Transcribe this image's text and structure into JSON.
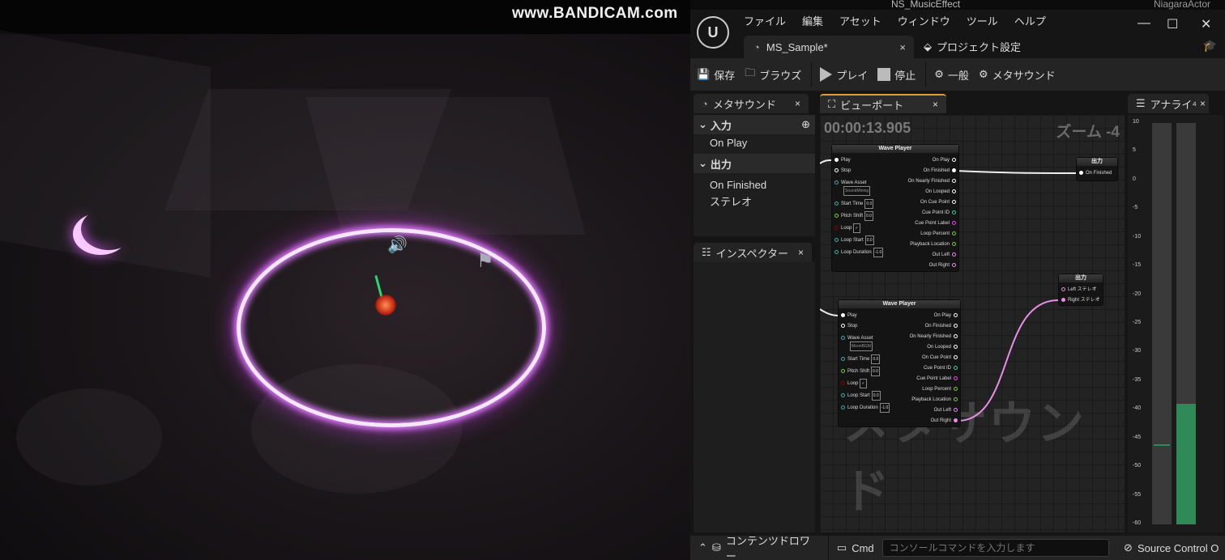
{
  "scene": {
    "watermark": "www.BANDICAM.com",
    "top_label_left": "NS_MusicEffect",
    "top_label_right": "NiagaraActor"
  },
  "window": {
    "logo": "U",
    "menu": [
      "ファイル",
      "編集",
      "アセット",
      "ウィンドウ",
      "ツール",
      "ヘルプ"
    ],
    "controls": {
      "minimize": "—",
      "maximize": "☐",
      "close": "✕"
    },
    "doc_tab": "MS_Sample*",
    "doc_tab_close": "×",
    "project_settings": "プロジェクト設定"
  },
  "toolbar": {
    "save": "保存",
    "browse": "ブラウズ",
    "play": "プレイ",
    "stop": "停止",
    "general": "一般",
    "metasound": "メタサウンド"
  },
  "panels": {
    "metasound_tab": "メタサウンド",
    "viewport_tab": "ビューポート",
    "analyzer_tab": "アナライ⁴",
    "inspector_tab": "インスペクター",
    "close": "×"
  },
  "members": {
    "inputs_header": "入力",
    "inputs": [
      "On Play"
    ],
    "outputs_header": "出力",
    "outputs": [
      "On Finished",
      "ステレオ"
    ]
  },
  "graph": {
    "timecode": "00:00:13.905",
    "zoom": "ズーム -4",
    "watermark": "メタサウンド",
    "nodes": [
      {
        "title": "Wave Player",
        "inputs": [
          "Play",
          "Stop",
          "Wave Asset",
          "Start Time",
          "Pitch Shift",
          "Loop",
          "Loop Start",
          "Loop Duration"
        ],
        "wave_asset": "SoundMining",
        "values": {
          "start_time": "0.0",
          "pitch_shift": "0.0",
          "loop": "✓",
          "loop_start": "0.0",
          "loop_duration": "-1.0"
        },
        "outputs": [
          "On Play",
          "On Finished",
          "On Nearly Finished",
          "On Looped",
          "On Cue Point",
          "Cue Point ID",
          "Cue Point Label",
          "Loop Percent",
          "Playback Location",
          "Out Left",
          "Out Right"
        ]
      },
      {
        "title": "Wave Player",
        "inputs": [
          "Play",
          "Stop",
          "Wave Asset",
          "Start Time",
          "Pitch Shift",
          "Loop",
          "Loop Start",
          "Loop Duration"
        ],
        "wave_asset": "MoonBGM",
        "values": {
          "start_time": "0.0",
          "pitch_shift": "0.0",
          "loop": "✓",
          "loop_start": "0.0",
          "loop_duration": "-1.0"
        },
        "outputs": [
          "On Play",
          "On Finished",
          "On Nearly Finished",
          "On Looped",
          "On Cue Point",
          "Cue Point ID",
          "Cue Point Label",
          "Loop Percent",
          "Playback Location",
          "Out Left",
          "Out Right"
        ]
      }
    ],
    "output_nodes": [
      {
        "title": "出力",
        "pins": [
          "On Finished"
        ]
      },
      {
        "title": "出力",
        "pins": [
          "Left ステレオ",
          "Right ステレオ"
        ]
      }
    ]
  },
  "analyzer": {
    "scale": [
      "10",
      "5",
      "0",
      "-5",
      "-10",
      "-15",
      "-20",
      "-25",
      "-30",
      "-35",
      "-40",
      "-45",
      "-50",
      "-55",
      "-60"
    ],
    "left_level": null,
    "right_level_db": -39,
    "left_peak_db": -46,
    "meter_color": "#2f8a57"
  },
  "statusbar": {
    "content_drawer": "コンテンツドロワー",
    "cmd": "Cmd",
    "console_placeholder": "コンソールコマンドを入力します",
    "source_control": "Source Control O"
  }
}
